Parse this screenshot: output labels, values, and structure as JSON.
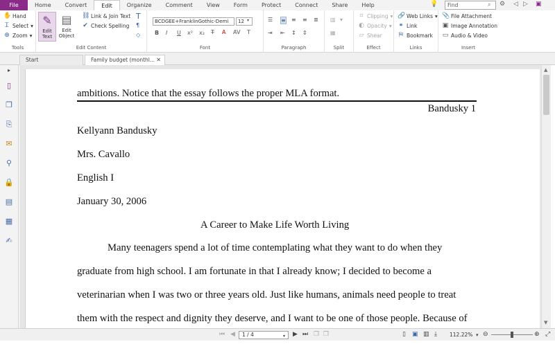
{
  "menu": {
    "tabs": [
      "File",
      "Home",
      "Convert",
      "Edit",
      "Organize",
      "Comment",
      "View",
      "Form",
      "Protect",
      "Connect",
      "Share",
      "Help"
    ],
    "active": "Edit",
    "find_placeholder": "Find"
  },
  "ribbon": {
    "tools": {
      "hand": "Hand",
      "select": "Select",
      "zoom": "Zoom",
      "label": "Tools"
    },
    "edit_content": {
      "edit_text": "Edit Text",
      "edit_object": "Edit Object",
      "link_join": "Link & Join Text",
      "check_spelling": "Check Spelling",
      "label": "Edit Content"
    },
    "font": {
      "family": "BCDGEE+FranklinGothic-Demi",
      "size": "12",
      "label": "Font"
    },
    "paragraph": {
      "label": "Paragraph"
    },
    "split": {
      "label": "Split"
    },
    "effect": {
      "clipping": "Clipping",
      "opacity": "Opacity",
      "shear": "Shear",
      "label": "Effect"
    },
    "links": {
      "web_links": "Web Links",
      "link": "Link",
      "bookmark": "Bookmark",
      "label": "Links"
    },
    "insert": {
      "file_attachment": "File Attachment",
      "image_annotation": "Image Annotation",
      "audio_video": "Audio & Video",
      "label": "Insert"
    }
  },
  "doc_tabs": [
    {
      "label": "Start"
    },
    {
      "label": "Family budget (monthl..."
    }
  ],
  "document": {
    "cut_line": "ambitions.  Notice that the essay follows the proper MLA format.",
    "header": "Bandusky 1",
    "name": "Kellyann Bandusky",
    "teacher": "Mrs. Cavallo",
    "course": "English I",
    "date": "January 30, 2006",
    "title": "A Career to Make Life Worth Living",
    "lines": [
      "Many teenagers spend a lot of time contemplating what they want to do when they",
      "graduate from high school.  I am fortunate in that I already know; I decided to become a",
      "veterinarian when I was two or three years old.  Just like humans, animals need people to treat",
      "them with the respect and dignity they deserve, and I want to be one of those people.  Because of"
    ]
  },
  "status": {
    "page": "1 / 4",
    "zoom": "112.22%"
  }
}
